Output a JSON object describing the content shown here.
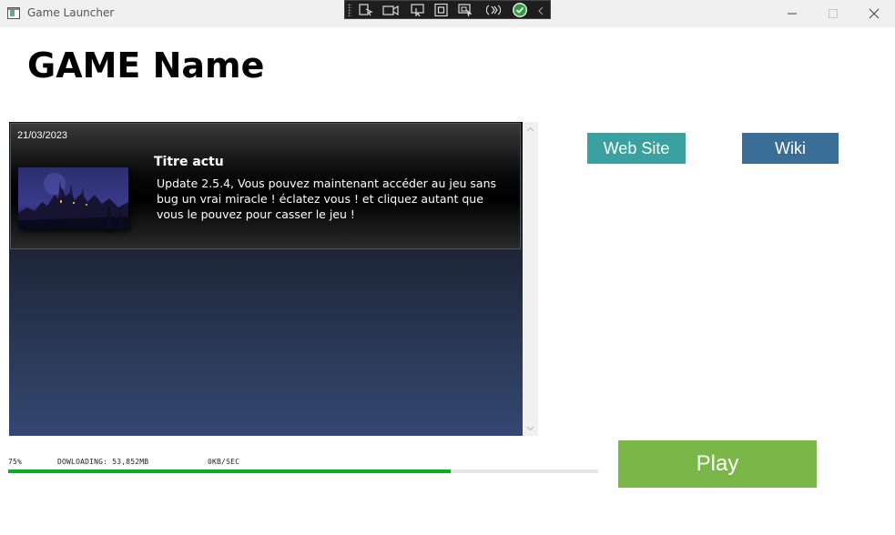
{
  "window": {
    "title": "Game Launcher"
  },
  "header": {
    "title": "GAME Name"
  },
  "news": {
    "items": [
      {
        "date": "21/03/2023",
        "headline": "Titre actu",
        "body": "Update 2.5.4, Vous pouvez maintenant accéder au jeu sans bug un vrai miracle ! éclatez vous ! et cliquez autant que vous le pouvez pour casser le jeu !",
        "thumbnail": "dark-castle-artwork"
      }
    ]
  },
  "links": {
    "website_label": "Web Site",
    "wiki_label": "Wiki"
  },
  "download": {
    "percent_label": "75%",
    "progress": 0.75,
    "status_label": "DOWLOADING: 53,852MB",
    "speed_label": "0KB/SEC"
  },
  "play": {
    "label": "Play"
  },
  "colors": {
    "website_button": "#3aa0a0",
    "wiki_button": "#3b6e96",
    "play_button": "#7ab648",
    "progress_fill": "#06b025"
  },
  "icons": {
    "debug_toolbar": [
      "select-element-icon",
      "record-icon",
      "pointer-icon",
      "layout-bounds-icon",
      "track-focus-icon",
      "hot-reload-icon",
      "check-icon",
      "collapse-chevron-icon"
    ],
    "window_controls": [
      "minimize-icon",
      "maximize-icon",
      "close-icon"
    ]
  }
}
